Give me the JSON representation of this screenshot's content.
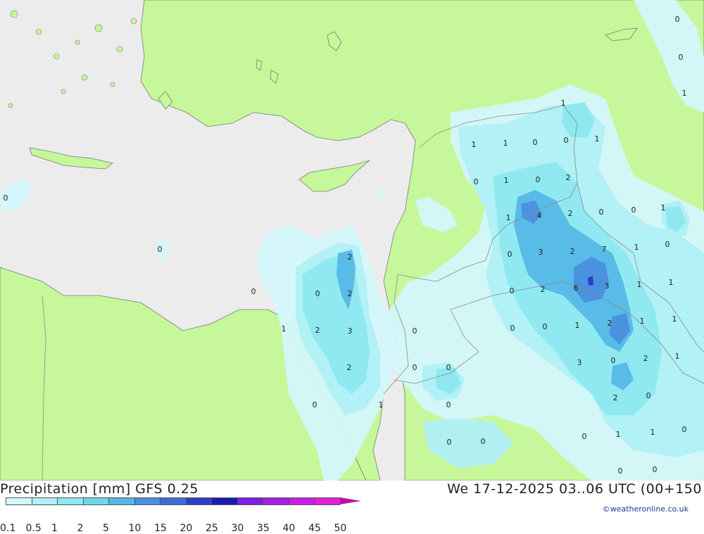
{
  "title": "Precipitation [mm]  GFS 0.25",
  "datetime": "We 17-12-2025 03..06 UTC (00+150",
  "credit": "©weatheronline.co.uk",
  "legend": {
    "labels": [
      "0.1",
      "0.5",
      "1",
      "2",
      "5",
      "10",
      "15",
      "20",
      "25",
      "30",
      "35",
      "40",
      "45",
      "50"
    ],
    "colors": [
      "#d4f7fb",
      "#b0f0f6",
      "#8ee8f0",
      "#6fd6ea",
      "#56b8e6",
      "#4a90e0",
      "#3c6cd8",
      "#2a3fc8",
      "#1a1ab0",
      "#7e1ee8",
      "#a51fe6",
      "#c61fe6",
      "#e11fd6",
      "#b8179c"
    ]
  },
  "map_colors": {
    "sea": "#ececec",
    "land": "#c6f79a",
    "border": "#8a8a8a",
    "coast": "#7a7a7a"
  },
  "values": [
    "0",
    "0",
    "1",
    "0",
    "0",
    "2",
    "2",
    "1",
    "2",
    "3",
    "2",
    "0",
    "0",
    "0",
    "0",
    "0",
    "0",
    "1",
    "1",
    "1",
    "0",
    "0",
    "1",
    "0",
    "1",
    "2",
    "4",
    "1",
    "2",
    "0",
    "0",
    "1",
    "0",
    "3",
    "2",
    "7",
    "1",
    "0",
    "0",
    "2",
    "6",
    "3",
    "1",
    "1",
    "0",
    "1",
    "2",
    "1",
    "1",
    "3",
    "0",
    "2",
    "1",
    "2",
    "0",
    "0",
    "1",
    "1",
    "0",
    "0",
    "0",
    "1",
    "0"
  ]
}
